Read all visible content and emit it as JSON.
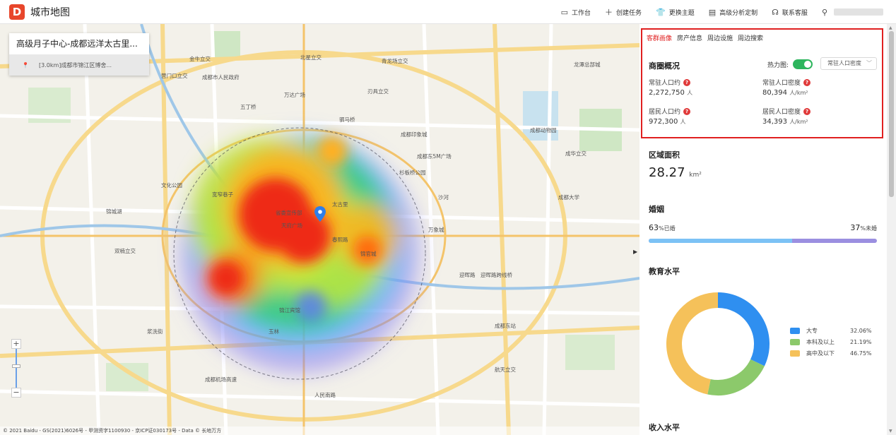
{
  "app": {
    "logo_letter": "D",
    "title": "城市地图"
  },
  "topnav": {
    "items": [
      {
        "icon": "monitor-icon",
        "label": "工作台"
      },
      {
        "icon": "plus-icon",
        "label": "创建任务"
      },
      {
        "icon": "shirt-icon",
        "label": "更换主题"
      },
      {
        "icon": "table-icon",
        "label": "高级分析定制"
      },
      {
        "icon": "headset-icon",
        "label": "联系客服"
      }
    ]
  },
  "search": {
    "title": "高级月子中心-成都远洋太古里...",
    "sub": "[3.0km]成都市锦江区博舍..."
  },
  "map": {
    "copyright": "© 2021 Baidu - GS(2021)6026号 - 甲测资字1100930 - 京ICP证030173号 - Data © 长地万方",
    "labels": [
      "北星立交",
      "青龙场立交",
      "刃具立交",
      "成都印象城",
      "五丁桥",
      "万达广场",
      "成都东5M广场",
      "杉板桥公园",
      "万象城",
      "迎晖路",
      "迎晖路跨线桥",
      "天府广场",
      "省委宣传部",
      "成都市人民政府",
      "锦江宾馆",
      "宽窄巷子",
      "文化公园",
      "双楠立交",
      "春熙路",
      "锦官城",
      "成都东站",
      "成都大学",
      "航天立交",
      "成华立交",
      "成都动物园",
      "龙潭总部城",
      "浆洗街",
      "玉林",
      "成都机场高速",
      "人民南路",
      "金牛立交",
      "营门口立交",
      "驷马桥",
      "沙河",
      "锦城湖",
      "太古里"
    ]
  },
  "panel": {
    "tabs": [
      "客群画像",
      "房产信息",
      "周边设施",
      "周边搜索"
    ],
    "active_tab": 0,
    "business": {
      "title": "商圈概况",
      "heatmap_label": "热力图:",
      "heatmap_on": true,
      "select_value": "常驻人口密度",
      "stats": [
        {
          "label": "常驻人口约",
          "value": "2,272,750",
          "unit": "人"
        },
        {
          "label": "常驻人口密度",
          "value": "80,394",
          "unit": "人/km²"
        },
        {
          "label": "居民人口约",
          "value": "972,300",
          "unit": "人"
        },
        {
          "label": "居民人口密度",
          "value": "34,393",
          "unit": "人/km²"
        }
      ]
    },
    "area": {
      "title": "区域面积",
      "value": "28.27",
      "unit": "km²"
    },
    "marriage": {
      "title": "婚姻",
      "married_pct": "63",
      "married_label": "%已婚",
      "single_pct": "37",
      "single_label": "%未婚",
      "married_fraction": 0.63
    },
    "education": {
      "title": "教育水平",
      "items": [
        {
          "name": "大专",
          "pct": "32.06%",
          "value": 32.06,
          "color": "#2f8ff0"
        },
        {
          "name": "本科及以上",
          "pct": "21.19%",
          "value": 21.19,
          "color": "#8cc96b"
        },
        {
          "name": "高中及以下",
          "pct": "46.75%",
          "value": 46.75,
          "color": "#f5c15a"
        }
      ]
    },
    "income": {
      "title": "收入水平"
    }
  }
}
